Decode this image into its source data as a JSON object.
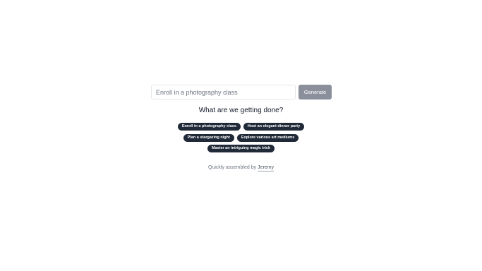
{
  "form": {
    "input_placeholder": "Enroll in a photography class",
    "input_value": "",
    "generate_label": "Generate"
  },
  "heading": "What are we getting done?",
  "suggestions": [
    "Enroll in a photography class",
    "Host an elegant dinner party",
    "Plan a stargazing night",
    "Explore various art mediums",
    "Master an intriguing magic trick"
  ],
  "footer": {
    "prefix": "Quickly assembled by",
    "author": "Jeremy"
  },
  "colors": {
    "button_bg": "#8a8f9b",
    "chip_bg": "#1f2937",
    "text": "#111827",
    "muted": "#6b7280"
  }
}
